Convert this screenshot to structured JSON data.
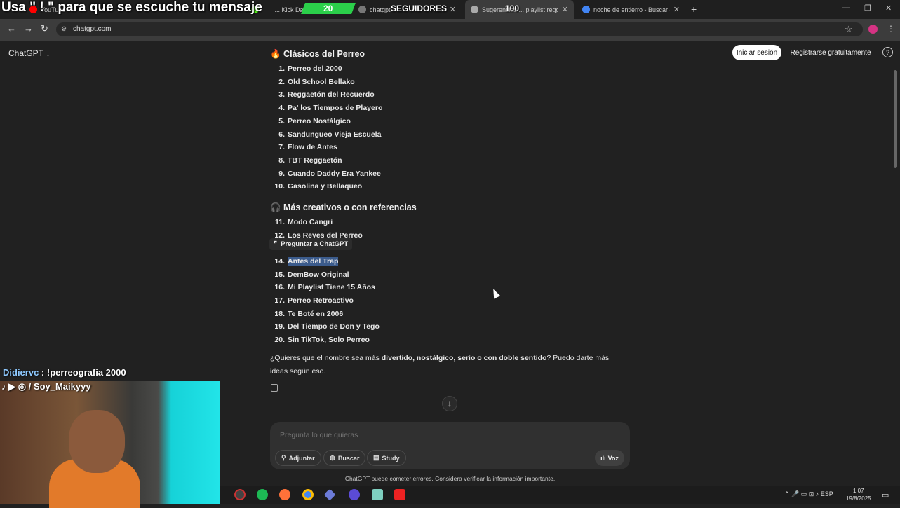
{
  "overlay": {
    "banner": "Usa \" ! \" para que se escuche tu mensaje",
    "counter_green": "20",
    "followers_label": "SEGUIDORES",
    "counter_top": "100",
    "chat_user": "Didiervc",
    "chat_message": " : !perreografia 2000",
    "socials": "♪ ▶ ◎ / Soy_Maikyyy"
  },
  "browser": {
    "tabs": [
      {
        "label": "YouTube",
        "color": "#ff0000"
      },
      {
        "label": "... Kick Dash",
        "color": "#53fc18"
      },
      {
        "label": "chatgpt",
        "color": "#888888"
      },
      {
        "label": "Sugerencias ... playlist reggaetón",
        "color": "#aaaaaa"
      },
      {
        "label": "noche de entierro - Buscar con",
        "color": "#4285f4"
      }
    ],
    "url": "chatgpt.com",
    "new_tab": "+"
  },
  "header": {
    "title": "ChatGPT",
    "login": "Iniciar sesión",
    "signup": "Registrarse gratuitamente",
    "help": "?"
  },
  "content": {
    "section1": "🔥 Clásicos del Perreo",
    "list1": [
      {
        "n": "1.",
        "t": "Perreo del 2000"
      },
      {
        "n": "2.",
        "t": "Old School Bellako"
      },
      {
        "n": "3.",
        "t": "Reggaetón del Recuerdo"
      },
      {
        "n": "4.",
        "t": "Pa' los Tiempos de Playero"
      },
      {
        "n": "5.",
        "t": "Perreo Nostálgico"
      },
      {
        "n": "6.",
        "t": "Sandungueo Vieja Escuela"
      },
      {
        "n": "7.",
        "t": "Flow de Antes"
      },
      {
        "n": "8.",
        "t": "TBT Reggaetón"
      },
      {
        "n": "9.",
        "t": "Cuando Daddy Era Yankee"
      },
      {
        "n": "10.",
        "t": "Gasolina y Bellaqueo"
      }
    ],
    "section2": "🎧 Más creativos o con referencias",
    "list2": [
      {
        "n": "11.",
        "t": "Modo Cangri"
      },
      {
        "n": "12.",
        "t": "Los Reyes del Perreo"
      },
      {
        "n": "14.",
        "t": "Antes del Trap"
      },
      {
        "n": "15.",
        "t": "DemBow Original"
      },
      {
        "n": "16.",
        "t": "Mi Playlist Tiene 15 Años"
      },
      {
        "n": "17.",
        "t": "Perreo Retroactivo"
      },
      {
        "n": "18.",
        "t": "Te Boté en 2006"
      },
      {
        "n": "19.",
        "t": "Del Tiempo de Don y Tego"
      },
      {
        "n": "20.",
        "t": "Sin TikTok, Solo Perreo"
      }
    ],
    "ask_popup": "Preguntar a ChatGPT",
    "followup_a": "¿Quieres que el nombre sea más ",
    "followup_b": "divertido, nostálgico, serio o con doble sentido",
    "followup_c": "? Puedo darte más ideas según eso."
  },
  "composer": {
    "placeholder": "Pregunta lo que quieras",
    "attach": "Adjuntar",
    "search": "Buscar",
    "study": "Study",
    "voice": "Voz"
  },
  "disclaimer": "ChatGPT puede cometer errores. Considera verificar la información importante.",
  "taskbar": {
    "lang": "ESP",
    "time": "1:07",
    "date": "19/8/2025"
  }
}
